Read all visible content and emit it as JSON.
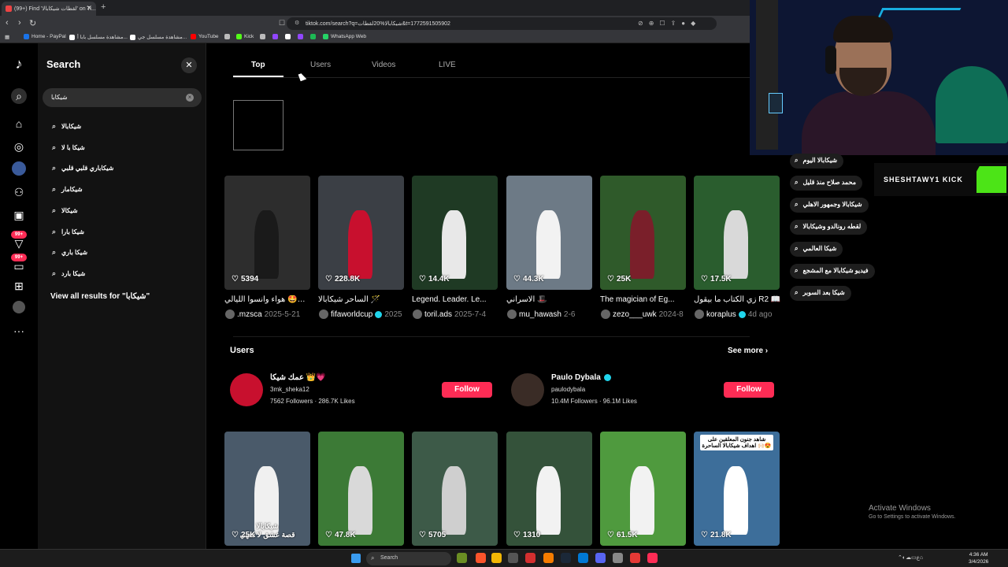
{
  "browser": {
    "tab_title": "(99+) Find 'لقطات شيكابالا' on Ti...",
    "url": "tiktok.com/search?q=شيكابالا%20لقطات&t=1772591505902",
    "bookmarks": [
      {
        "label": "Home - PayPal",
        "color": "#1a73e8"
      },
      {
        "label": "مشاهدة مسلسل بابا أ...",
        "color": "#ffffff"
      },
      {
        "label": "مشاهدة مسلسل جي...",
        "color": "#ffffff"
      },
      {
        "label": "YouTube",
        "color": "#ff0000"
      },
      {
        "label": "",
        "color": "#bbbbbb"
      },
      {
        "label": "Kick",
        "color": "#53fc18"
      },
      {
        "label": "",
        "color": "#bbbbbb"
      },
      {
        "label": "",
        "color": "#9146ff"
      },
      {
        "label": "",
        "color": "#ffffff"
      },
      {
        "label": "",
        "color": "#9146ff"
      },
      {
        "label": "",
        "color": "#1db954"
      },
      {
        "label": "WhatsApp Web",
        "color": "#25d366"
      }
    ]
  },
  "search_panel": {
    "title": "Search",
    "query": "شيكابا",
    "suggestions": [
      "شيكابالا",
      "شيكا با لا",
      "شيكاباري قلبي قلبي",
      "شيكامار",
      "شيكالا",
      "شيكا بارا",
      "شيكا باري",
      "شيكا بارد"
    ],
    "view_all": "View all results for \"شيكابا\""
  },
  "main": {
    "tabs": [
      "Top",
      "Users",
      "Videos",
      "LIVE"
    ],
    "videos_row1": [
      {
        "likes": "5394",
        "caption": "هواء وانسوا الليالي 🤩🖤🤍",
        "author": ".mzsca",
        "date": "2025-5-21",
        "verified": false,
        "bg": "#2d2d2d",
        "player": "#1a1a1a"
      },
      {
        "likes": "228.8K",
        "caption": "الساحر شيكابالا 🪄",
        "author": "fifaworldcup",
        "date": "2025",
        "verified": true,
        "bg": "#3b3f45",
        "player": "#c8102e"
      },
      {
        "likes": "14.4K",
        "caption": "Legend. Leader. Le...",
        "author": "toril.ads",
        "date": "2025-7-4",
        "verified": false,
        "bg": "#1f3a24",
        "player": "#e8e8e8"
      },
      {
        "likes": "44.3K",
        "caption": "الاسراني 🎩",
        "author": "mu_hawash",
        "date": "2-6",
        "verified": false,
        "bg": "#6d7a86",
        "player": "#f2f2f2"
      },
      {
        "likes": "25K",
        "caption": "The magician of Eg...",
        "author": "zezo___uwk",
        "date": "2024-8",
        "verified": false,
        "bg": "#2f5a2a",
        "player": "#7a1f2a"
      },
      {
        "likes": "17.5K",
        "caption": "زي الكتاب ما بيقول R2 📖",
        "author": "koraplus",
        "date": "4d ago",
        "verified": true,
        "bg": "#2a5d2e",
        "player": "#d9d9d9"
      }
    ],
    "users_section": {
      "title": "Users",
      "see_more": "See more",
      "users": [
        {
          "name": "عمك شيكا 👑💗",
          "handle": "3mk_sheka12",
          "followers": "7562 Followers",
          "likes": "286.7K Likes",
          "verified": false,
          "follow": "Follow"
        },
        {
          "name": "Paulo Dybala",
          "handle": "paulodybala",
          "followers": "10.4M Followers",
          "likes": "96.1M Likes",
          "verified": true,
          "follow": "Follow"
        }
      ]
    },
    "videos_row2": [
      {
        "likes": "25K",
        "overlay": "شيكابالا\nقصة عشق لا تنتهي",
        "bg": "#4a5a6a",
        "player": "#f0f0f0"
      },
      {
        "likes": "47.8K",
        "overlay": "",
        "bg": "#3c7a36",
        "player": "#d9d9d9"
      },
      {
        "likes": "5705",
        "overlay": "",
        "bg": "#3d5a48",
        "player": "#cfcfcf"
      },
      {
        "likes": "1310",
        "overlay": "",
        "bg": "#34523a",
        "player": "#f2f2f2"
      },
      {
        "likes": "61.5K",
        "overlay": "",
        "bg": "#4f9a3e",
        "player": "#f2f2f2"
      },
      {
        "likes": "21.8K",
        "overlay": "شاهد جنون المعلقين على اهداف شيكابالا الساحرة 🙌🏻😍",
        "bg": "#3d6e9a",
        "player": "#ffffff"
      }
    ]
  },
  "overlay": {
    "suggestions": [
      "شيكابالا اليوم",
      "محمد صلاح منذ قليل",
      "شيكابالا وجمهور الاهلي",
      "لقطه رونالدو وشيكابالا",
      "شيكا العالمي",
      "فيديو شيكابالا مع المشجع",
      "شيكا بعد السوبر"
    ],
    "kick_handle": "SHESHTAWY1 KICK",
    "activate_title": "Activate Windows",
    "activate_sub": "Go to Settings to activate Windows."
  },
  "taskbar": {
    "search_placeholder": "Search",
    "time": "4:36 AM",
    "date": "3/4/2026"
  }
}
